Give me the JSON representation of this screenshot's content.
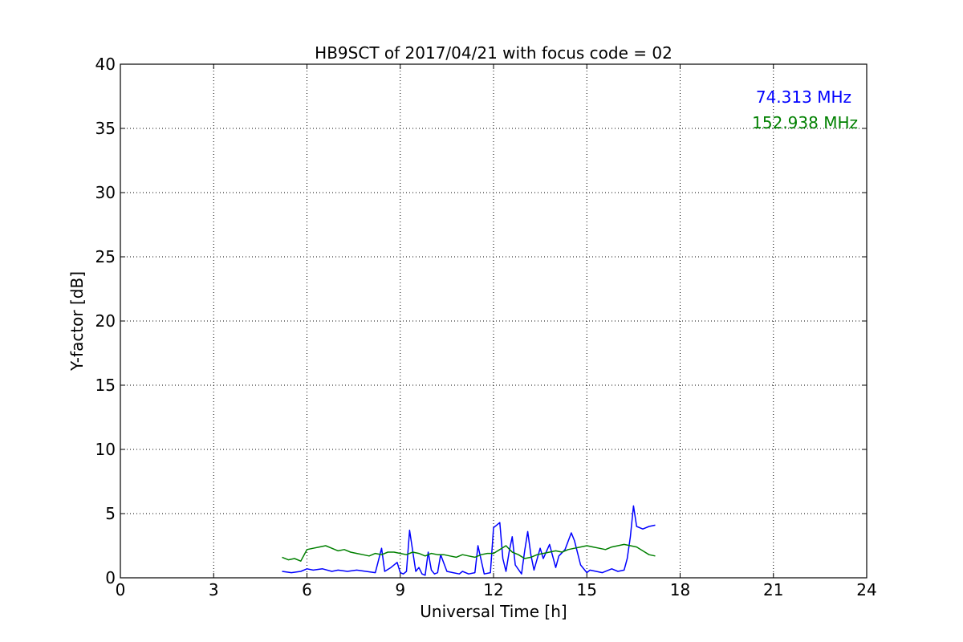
{
  "chart_data": {
    "type": "line",
    "title": "HB9SCT of 2017/04/21 with focus code = 02",
    "xlabel": "Universal Time [h]",
    "ylabel": "Y-factor [dB]",
    "xlim": [
      0,
      24
    ],
    "ylim": [
      0,
      40
    ],
    "xticks": [
      0,
      3,
      6,
      9,
      12,
      15,
      18,
      21,
      24
    ],
    "yticks": [
      0,
      5,
      10,
      15,
      20,
      25,
      30,
      35,
      40
    ],
    "grid": true,
    "legend_position": "top-right",
    "series": [
      {
        "name": "74.313 MHz",
        "color": "#0000ff",
        "x": [
          5.2,
          5.5,
          5.8,
          6.0,
          6.2,
          6.5,
          6.8,
          7.0,
          7.3,
          7.6,
          7.9,
          8.2,
          8.4,
          8.5,
          8.7,
          8.9,
          9.0,
          9.1,
          9.2,
          9.3,
          9.5,
          9.6,
          9.7,
          9.8,
          9.9,
          10.0,
          10.1,
          10.2,
          10.3,
          10.5,
          10.7,
          10.9,
          11.0,
          11.2,
          11.4,
          11.5,
          11.7,
          11.9,
          12.0,
          12.2,
          12.3,
          12.4,
          12.5,
          12.6,
          12.7,
          12.9,
          13.0,
          13.1,
          13.2,
          13.3,
          13.5,
          13.6,
          13.8,
          14.0,
          14.1,
          14.3,
          14.5,
          14.6,
          14.8,
          15.0,
          15.1,
          15.3,
          15.5,
          15.8,
          16.0,
          16.2,
          16.3,
          16.4,
          16.5,
          16.6,
          16.8,
          17.0,
          17.2
        ],
        "values": [
          0.5,
          0.4,
          0.5,
          0.7,
          0.6,
          0.7,
          0.5,
          0.6,
          0.5,
          0.6,
          0.5,
          0.4,
          2.3,
          0.5,
          0.8,
          1.2,
          0.4,
          0.3,
          0.5,
          3.7,
          0.5,
          0.8,
          0.3,
          0.2,
          2.0,
          0.6,
          0.3,
          0.4,
          1.8,
          0.5,
          0.4,
          0.3,
          0.5,
          0.3,
          0.4,
          2.5,
          0.3,
          0.4,
          3.9,
          4.3,
          1.5,
          0.5,
          2.0,
          3.2,
          1.0,
          0.3,
          2.1,
          3.6,
          1.8,
          0.6,
          2.3,
          1.5,
          2.6,
          0.8,
          1.7,
          2.2,
          3.5,
          2.9,
          1.0,
          0.4,
          0.6,
          0.5,
          0.4,
          0.7,
          0.5,
          0.6,
          1.5,
          3.2,
          5.6,
          4.0,
          3.8,
          4.0,
          4.1
        ]
      },
      {
        "name": "152.938 MHz",
        "color": "#008000",
        "x": [
          5.2,
          5.4,
          5.6,
          5.8,
          6.0,
          6.2,
          6.4,
          6.6,
          6.8,
          7.0,
          7.2,
          7.4,
          7.6,
          7.8,
          8.0,
          8.2,
          8.4,
          8.6,
          8.8,
          9.0,
          9.2,
          9.4,
          9.6,
          9.8,
          10.0,
          10.2,
          10.4,
          10.6,
          10.8,
          11.0,
          11.2,
          11.4,
          11.6,
          11.8,
          12.0,
          12.2,
          12.4,
          12.6,
          12.8,
          13.0,
          13.2,
          13.4,
          13.6,
          13.8,
          14.0,
          14.2,
          14.4,
          14.6,
          14.8,
          15.0,
          15.2,
          15.4,
          15.6,
          15.8,
          16.0,
          16.2,
          16.4,
          16.6,
          16.8,
          17.0,
          17.2
        ],
        "values": [
          1.6,
          1.4,
          1.5,
          1.3,
          2.2,
          2.3,
          2.4,
          2.5,
          2.3,
          2.1,
          2.2,
          2.0,
          1.9,
          1.8,
          1.7,
          1.9,
          1.8,
          2.0,
          2.0,
          1.9,
          1.8,
          2.0,
          1.9,
          1.7,
          1.9,
          1.8,
          1.8,
          1.7,
          1.6,
          1.8,
          1.7,
          1.6,
          1.8,
          1.9,
          1.9,
          2.2,
          2.5,
          2.0,
          1.8,
          1.5,
          1.6,
          1.8,
          1.9,
          2.0,
          2.1,
          2.0,
          2.2,
          2.3,
          2.4,
          2.5,
          2.4,
          2.3,
          2.2,
          2.4,
          2.5,
          2.6,
          2.5,
          2.4,
          2.1,
          1.8,
          1.7
        ]
      }
    ]
  }
}
